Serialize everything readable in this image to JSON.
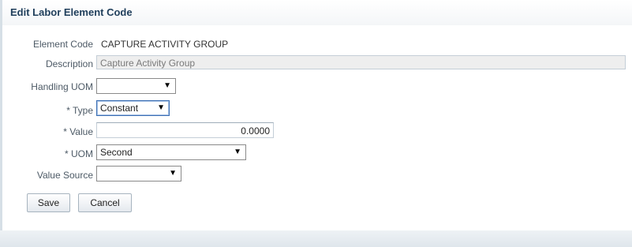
{
  "dialog": {
    "title": "Edit Labor Element Code"
  },
  "form": {
    "element_code": {
      "label": "Element Code",
      "value": "CAPTURE ACTIVITY GROUP"
    },
    "description": {
      "label": "Description",
      "value": "Capture Activity Group"
    },
    "handling_uom": {
      "label": "Handling UOM",
      "value": ""
    },
    "type": {
      "label": "* Type",
      "value": "Constant"
    },
    "value": {
      "label": "* Value",
      "value": "0.0000"
    },
    "uom": {
      "label": "* UOM",
      "value": "Second"
    },
    "value_source": {
      "label": "Value Source",
      "value": ""
    }
  },
  "buttons": {
    "save_label": "Save",
    "cancel_label": "Cancel"
  },
  "icons": {
    "dropdown_arrow": "▼"
  }
}
